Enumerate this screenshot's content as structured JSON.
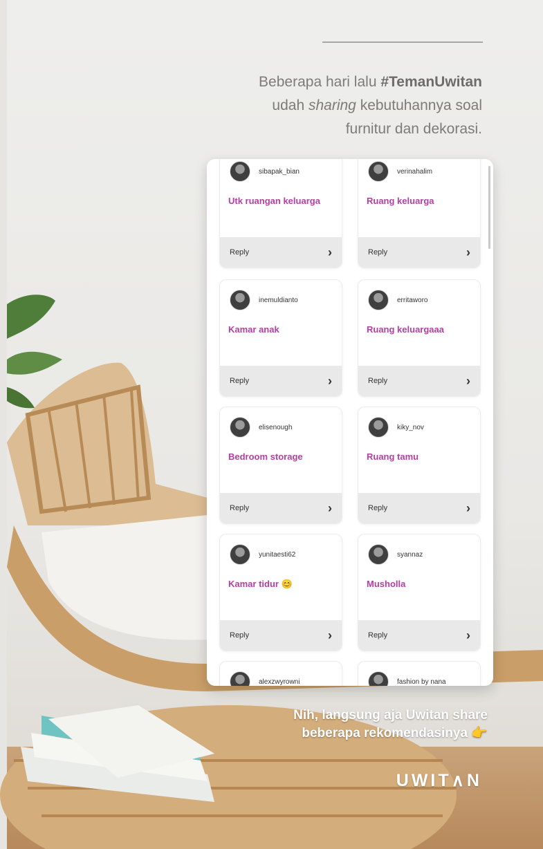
{
  "headline": {
    "prefix": "Beberapa hari lalu ",
    "hashtag": "#TemanUwitan",
    "line2a": "udah ",
    "line2b": "sharing",
    "line2c": " kebutuhannya soal",
    "line3": "furnitur dan dekorasi."
  },
  "replies": [
    {
      "username": "sibapak_bian",
      "message": "Utk ruangan keluarga",
      "reply": "Reply"
    },
    {
      "username": "verinahalim",
      "message": "Ruang keluarga",
      "reply": "Reply"
    },
    {
      "username": "inemuldianto",
      "message": "Kamar anak",
      "reply": "Reply"
    },
    {
      "username": "erritaworo",
      "message": "Ruang keluargaaa",
      "reply": "Reply"
    },
    {
      "username": "elisenough",
      "message": "Bedroom storage",
      "reply": "Reply"
    },
    {
      "username": "kiky_nov",
      "message": "Ruang tamu",
      "reply": "Reply"
    },
    {
      "username": "yunitaesti62",
      "message": "Kamar tidur 😊",
      "reply": "Reply"
    },
    {
      "username": "syannaz",
      "message": "Musholla",
      "reply": "Reply"
    },
    {
      "username": "alexzwyrowni",
      "message": "",
      "reply": ""
    },
    {
      "username": "fashion by nana",
      "message": "",
      "reply": ""
    }
  ],
  "caption": {
    "line1": "Nih, langsung aja Uwitan share",
    "line2": "beberapa rekomendasinya 👉"
  },
  "logo": "UWIT∧N",
  "colors": {
    "message": "#b23fa3",
    "reply_bar": "#e9e9e9",
    "headline": "#7d7b78"
  },
  "icons": {
    "chevron": "chevron-right-icon",
    "avatar": "avatar"
  }
}
